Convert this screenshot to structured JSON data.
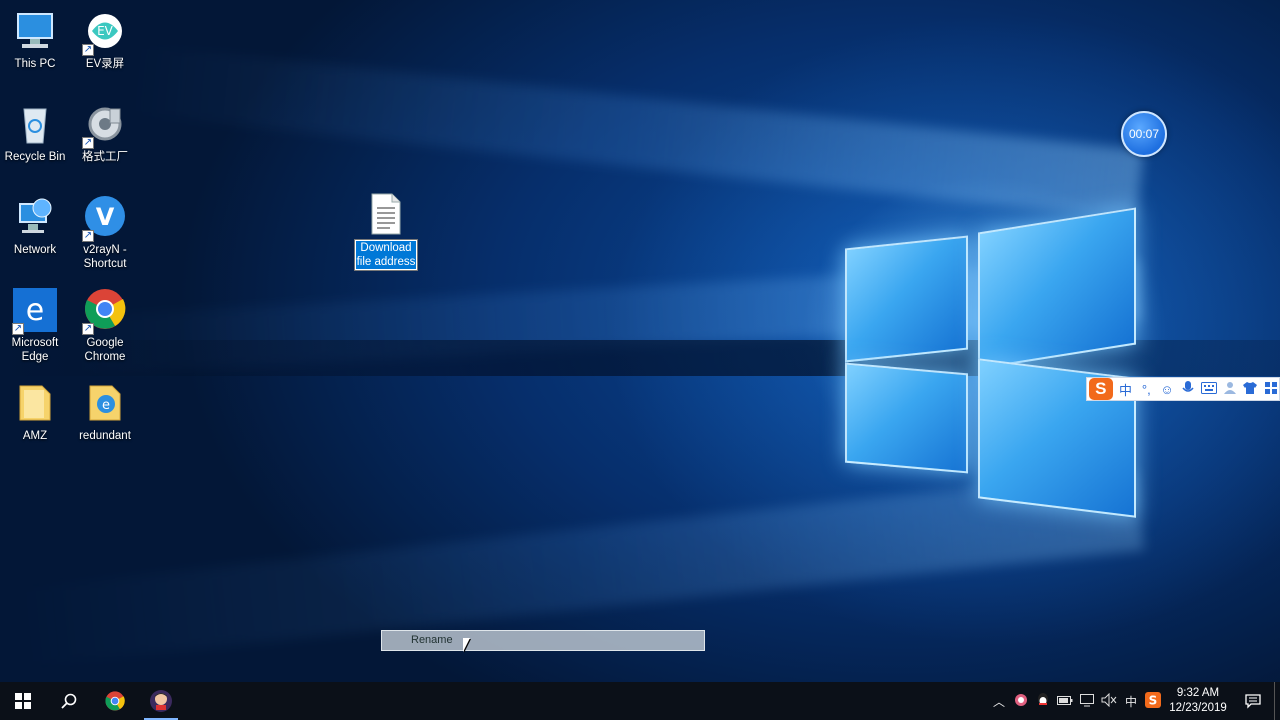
{
  "desktop": {
    "icons": [
      {
        "label": "This PC",
        "icon": "this-pc-icon"
      },
      {
        "label": "EV录屏",
        "icon": "ev-recorder-icon"
      },
      {
        "label": "Recycle Bin",
        "icon": "recycle-bin-icon"
      },
      {
        "label": "格式工厂",
        "icon": "format-factory-icon"
      },
      {
        "label": "Network",
        "icon": "network-icon"
      },
      {
        "label": "v2rayN - Shortcut",
        "icon": "v2rayn-icon"
      },
      {
        "label": "Microsoft Edge",
        "icon": "edge-icon"
      },
      {
        "label": "Google Chrome",
        "icon": "chrome-icon"
      },
      {
        "label": "AMZ",
        "icon": "folder-icon"
      },
      {
        "label": "redundant",
        "icon": "redundant-folder-icon"
      }
    ],
    "renaming_file": {
      "value": "Download file address",
      "icon": "text-file-icon"
    }
  },
  "timer": {
    "text": "00:07"
  },
  "ime_toolbar": {
    "logo": "S",
    "lang": "中",
    "items": [
      "punctuation-icon",
      "emoji-icon",
      "microphone-icon",
      "keyboard-icon",
      "user-icon",
      "skin-icon",
      "toolbox-icon"
    ]
  },
  "rename_bar": {
    "label": "Rename"
  },
  "taskbar": {
    "tray_lang": "中",
    "clock_time": "9:32 AM",
    "clock_date": "12/23/2019"
  },
  "colors": {
    "accent": "#0078d7",
    "taskbar": "#0b1018",
    "ime_orange": "#f26a1b"
  }
}
